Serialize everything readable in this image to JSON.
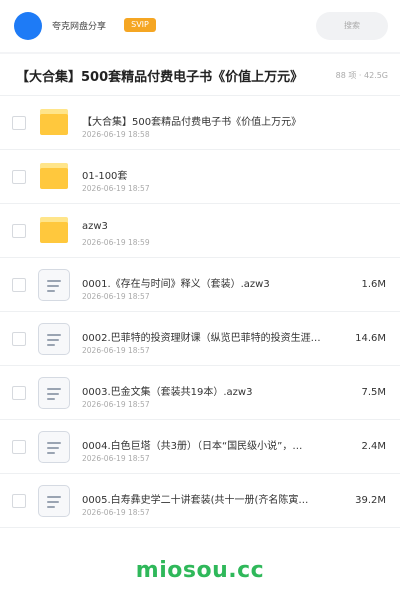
{
  "header": {
    "share_name": "夸克网盘分享",
    "badge": "SVIP",
    "search_placeholder": "搜索"
  },
  "folder": {
    "title": "【大合集】500套精品付费电子书《价值上万元》",
    "meta": "88 项 · 42.5G"
  },
  "items": [
    {
      "type": "folder",
      "name": "【大合集】500套精品付费电子书《价值上万元》",
      "date": "2026-06-19 18:58",
      "size": ""
    },
    {
      "type": "folder",
      "name": "01-100套",
      "date": "2026-06-19 18:57",
      "size": ""
    },
    {
      "type": "folder",
      "name": "azw3",
      "date": "2026-06-19 18:59",
      "size": ""
    },
    {
      "type": "file",
      "name": "0001.《存在与时间》释义（套装）.azw3",
      "date": "2026-06-19 18:57",
      "size": "1.6M"
    },
    {
      "type": "file",
      "name": "0002.巴菲特的投资理财课（纵览巴菲特的投资生涯…",
      "date": "2026-06-19 18:57",
      "size": "14.6M"
    },
    {
      "type": "file",
      "name": "0003.巴金文集（套装共19本）.azw3",
      "date": "2026-06-19 18:57",
      "size": "7.5M"
    },
    {
      "type": "file",
      "name": "0004.白色巨塔（共3册）（日本“国民级小说”，…",
      "date": "2026-06-19 18:57",
      "size": "2.4M"
    },
    {
      "type": "file",
      "name": "0005.白寿彝史学二十讲套装(共十一册(齐名陈寅…",
      "date": "2026-06-19 18:57",
      "size": "39.2M"
    }
  ],
  "watermark": "miosou.cc",
  "colors": {
    "avatar": "#1e7bf6",
    "svip_badge": "#f5a623",
    "folder_icon": "#ffc83d",
    "watermark": "#2fb85a"
  }
}
